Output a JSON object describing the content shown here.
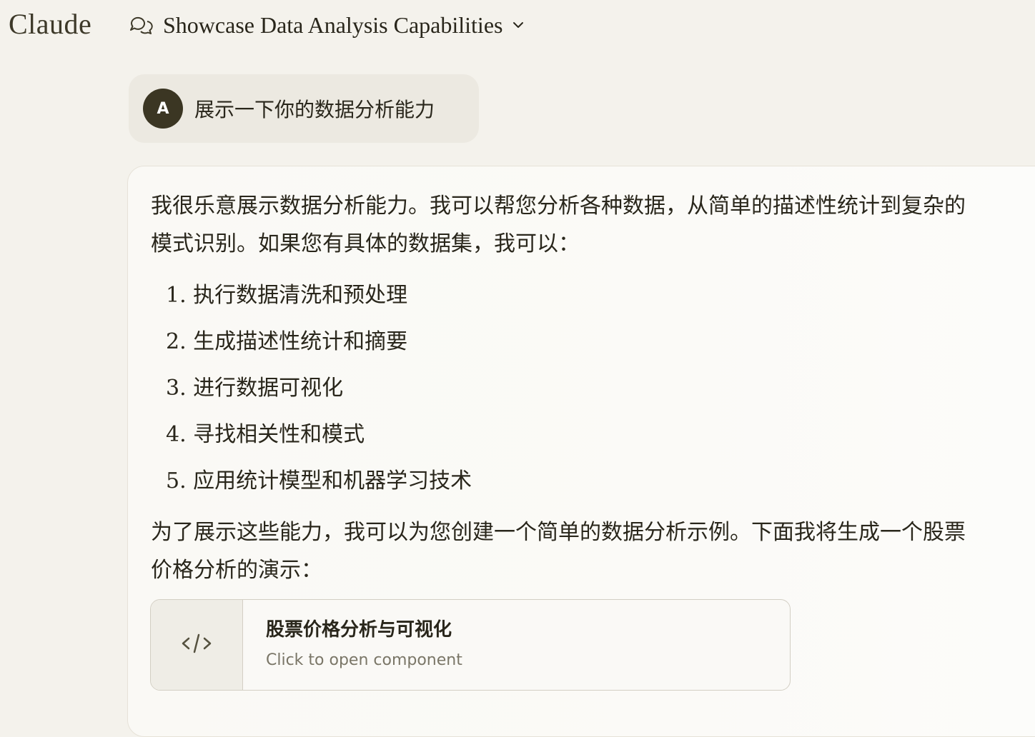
{
  "app": {
    "brand": "Claude"
  },
  "header": {
    "chat_title": "Showcase Data Analysis Capabilities",
    "chat_icon": "chat-bubbles-icon",
    "dropdown_icon": "chevron-down-icon"
  },
  "user_message": {
    "avatar_initial": "A",
    "text": "展示一下你的数据分析能力"
  },
  "assistant_message": {
    "intro": "我很乐意展示数据分析能力。我可以帮您分析各种数据，从简单的描述性统计到复杂的模式识别。如果您有具体的数据集，我可以：",
    "steps": [
      "1. 执行数据清洗和预处理",
      "2. 生成描述性统计和摘要",
      "3. 进行数据可视化",
      "4. 寻找相关性和模式",
      "5. 应用统计模型和机器学习技术"
    ],
    "outro": "为了展示这些能力，我可以为您创建一个简单的数据分析示例。下面我将生成一个股票价格分析的演示：",
    "artifact": {
      "title": "股票价格分析与可视化",
      "subtitle": "Click to open component",
      "icon": "code-icon"
    }
  },
  "colors": {
    "background": "#f4f2ec",
    "user_bubble": "#ece9e1",
    "avatar": "#3b3623",
    "text": "#29261b",
    "muted_text": "#7a7667"
  }
}
